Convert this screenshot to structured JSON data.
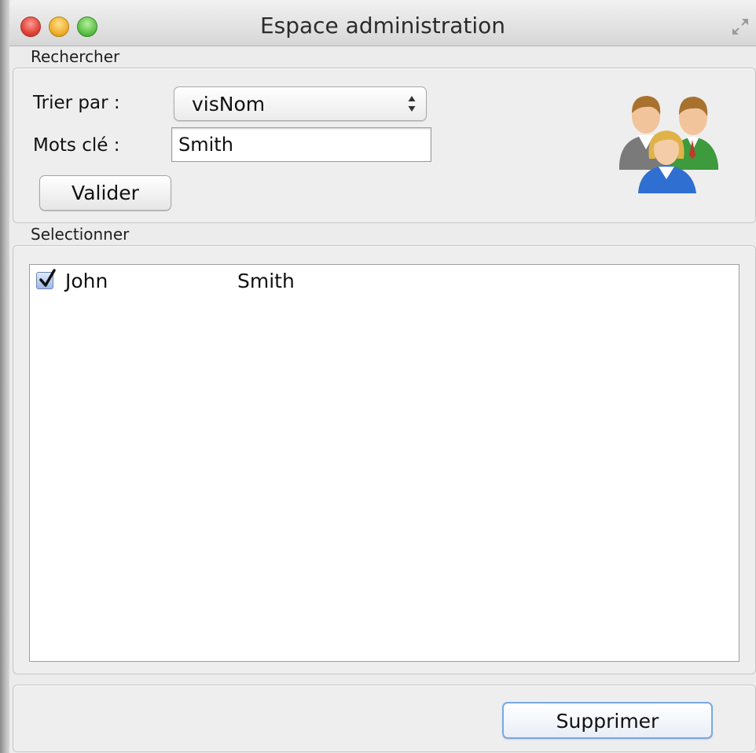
{
  "window": {
    "title": "Espace administration"
  },
  "search_group": {
    "label": "Rechercher",
    "sort_label": "Trier par :",
    "sort_value": "visNom",
    "keywords_label": "Mots clé :",
    "keywords_value": "Smith",
    "submit_label": "Valider",
    "icon": "users-group-icon"
  },
  "select_group": {
    "label": "Selectionner",
    "rows": [
      {
        "checked": true,
        "first_name": "John",
        "last_name": "Smith"
      }
    ]
  },
  "footer": {
    "delete_label": "Supprimer"
  },
  "colors": {
    "window_bg": "#ececec",
    "list_bg": "#ffffff",
    "default_button_border": "#7aa8e8",
    "checkbox_blue": "#9db8e8"
  }
}
